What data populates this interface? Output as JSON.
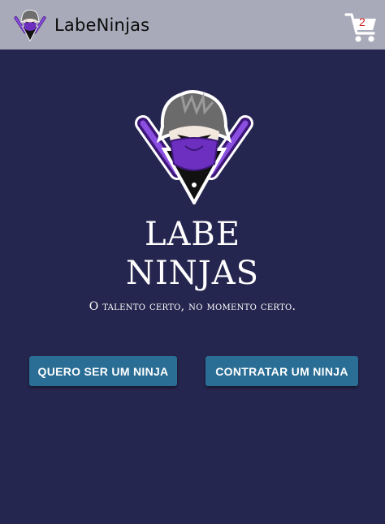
{
  "header": {
    "title": "LabeNinjas",
    "logo_icon": "ninja-mascot-icon",
    "cart_icon": "shopping-cart-icon",
    "cart_count": "2"
  },
  "hero": {
    "logo_icon": "ninja-mascot-icon",
    "title_line1": "LABE",
    "title_line2": "NINJAS",
    "tagline": "O talento certo, no momento certo."
  },
  "buttons": {
    "be_ninja": "QUERO SER UM NINJA",
    "hire_ninja": "CONTRATAR UM NINJA"
  },
  "colors": {
    "background": "#25264f",
    "header": "#a8aab9",
    "button": "#2a6e95",
    "accent_purple": "#6c2fc0"
  }
}
